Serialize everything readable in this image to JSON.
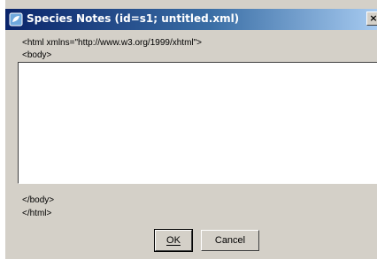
{
  "window": {
    "title": "Species Notes (id=s1; untitled.xml)",
    "close_label": "×"
  },
  "editor": {
    "header_line_1": "<html xmlns=\"http://www.w3.org/1999/xhtml\">",
    "header_line_2": "<body>",
    "content": "",
    "footer_line_1": "</body>",
    "footer_line_2": "</html>"
  },
  "buttons": {
    "ok_label": "OK",
    "cancel_label": "Cancel"
  },
  "icons": {
    "app": "app-window-icon",
    "close": "close-icon"
  },
  "colors": {
    "title_bar_start": "#0a246a",
    "title_bar_end": "#a6caf0",
    "window_background": "#d4d0c8"
  }
}
